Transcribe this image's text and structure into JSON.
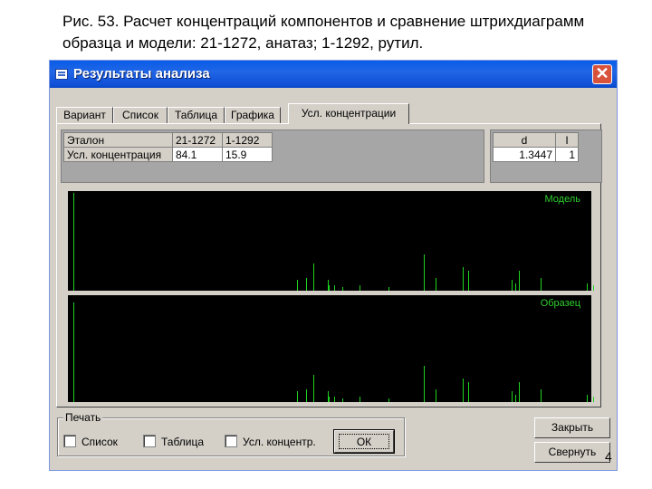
{
  "caption": "Рис. 53. Расчет концентраций компонентов и сравнение штрихдиаграмм образца и модели: 21-1272, анатаз; 1-1292, рутил.",
  "window": {
    "title": "Результаты анализа",
    "close_glyph": "✕"
  },
  "tabs": [
    "Вариант",
    "Список",
    "Таблица",
    "Графика",
    "Усл. концентрации"
  ],
  "active_tab": "Усл. концентрации",
  "grid": {
    "row1": {
      "label": "Эталон",
      "c1": "21-1272",
      "c2": "1-1292"
    },
    "row2": {
      "label": "Усл. концентрация",
      "c1": "84.1",
      "c2": "15.9"
    }
  },
  "grid2": {
    "headers": [
      "d",
      "I"
    ],
    "values": [
      "1.3447",
      "1"
    ]
  },
  "plot_model": {
    "label": "Модель",
    "line_color": "#1ed31e"
  },
  "plot_sample": {
    "label": "Образец",
    "line_color": "#1ed31e"
  },
  "print_group": {
    "legend": "Печать",
    "options": [
      "Список",
      "Таблица",
      "Усл. концентр."
    ]
  },
  "buttons": {
    "ok": "ОК",
    "close": "Закрыть",
    "minimize": "Свернуть"
  },
  "page_number": "4"
}
